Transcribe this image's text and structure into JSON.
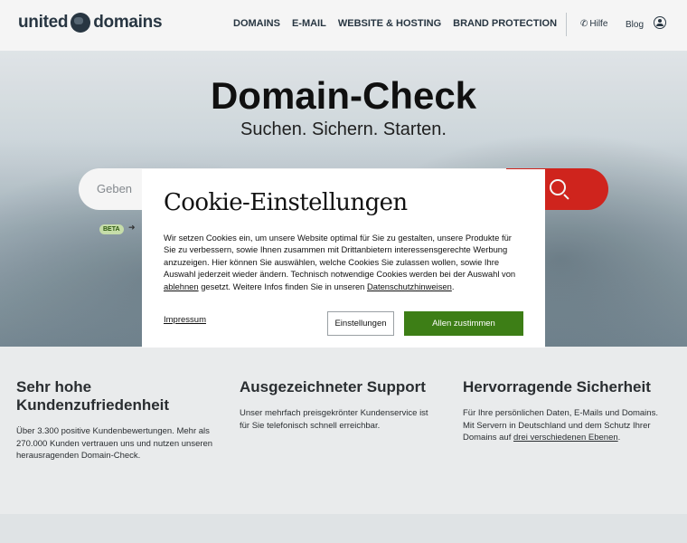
{
  "header": {
    "logo_left": "united",
    "logo_right": "domains",
    "nav": [
      "DOMAINS",
      "E-MAIL",
      "WEBSITE & HOSTING",
      "BRAND PROTECTION"
    ],
    "help_label": "Hilfe",
    "blog_label": "Blog"
  },
  "hero": {
    "title": "Domain-Check",
    "subtitle": "Suchen. Sichern. Starten.",
    "search_placeholder": "Geben Sie",
    "beta_badge": "BETA"
  },
  "features": [
    {
      "title": "Sehr hohe Kundenzufriedenheit",
      "text": "Über 3.300 positive Kundenbewertungen. Mehr als 270.000 Kunden vertrauen uns und nutzen unseren herausragenden Domain-Check."
    },
    {
      "title": "Ausgezeichneter Support",
      "text": "Unser mehrfach preisgekrönter Kundenservice ist für Sie telefonisch schnell erreichbar."
    },
    {
      "title": "Hervorragende Sicherheit",
      "text": "Für Ihre persönlichen Daten, E-Mails und Domains. Mit Servern in Deutschland und dem Schutz Ihrer Domains auf ",
      "link": "drei verschiedenen Ebenen",
      "text_end": "."
    }
  ],
  "cookie": {
    "title": "Cookie-Einstellungen",
    "text_part1": "Wir setzen Cookies ein, um unsere Website optimal für Sie zu gestalten, unsere Produkte für Sie zu verbessern, sowie Ihnen zusammen mit Drittanbietern interessensgerechte Werbung anzuzeigen. Hier können Sie auswählen, welche Cookies Sie zulassen wollen, sowie Ihre Auswahl jederzeit wieder ändern. Technisch notwendige Cookies werden bei der Auswahl von ",
    "link_reject": "ablehnen",
    "text_part2": " gesetzt. Weitere Infos finden Sie in unseren ",
    "link_privacy": "Datenschutzhinweisen",
    "text_part3": ".",
    "impressum": "Impressum",
    "settings_button": "Einstellungen",
    "accept_button": "Allen zustimmen"
  },
  "colors": {
    "accent_red": "#d8261f",
    "accept_green": "#3d7e16",
    "brand_dark": "#2a3945"
  }
}
